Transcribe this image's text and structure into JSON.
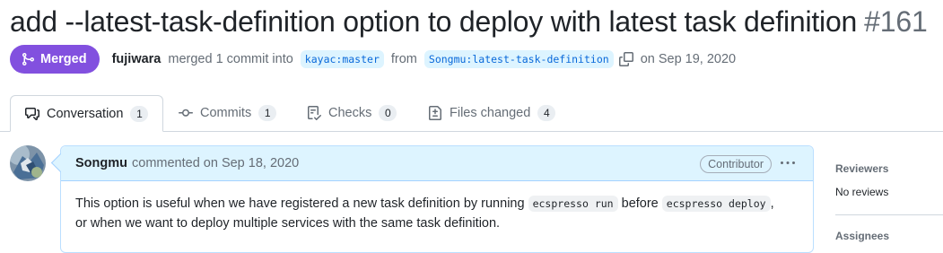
{
  "pr": {
    "title": "add --latest-task-definition option to deploy with latest task definition",
    "number": "#161"
  },
  "meta": {
    "status": "Merged",
    "merger": "fujiwara",
    "merged_text": "merged 1 commit into",
    "base_ref": "kayac:master",
    "from_text": "from",
    "head_ref": "Songmu:latest-task-definition",
    "date_text": "on Sep 19, 2020",
    "status_color": "#8250df"
  },
  "tabs": [
    {
      "label": "Conversation",
      "count": "1",
      "icon": "comment-discussion-icon"
    },
    {
      "label": "Commits",
      "count": "1",
      "icon": "git-commit-icon"
    },
    {
      "label": "Checks",
      "count": "0",
      "icon": "checklist-icon"
    },
    {
      "label": "Files changed",
      "count": "4",
      "icon": "file-diff-icon"
    }
  ],
  "comment": {
    "author": "Songmu",
    "action": "commented on Sep 18, 2020",
    "role": "Contributor",
    "body": {
      "part1": "This option is useful when we have registered a new task definition by running",
      "code1": "ecspresso run",
      "part2": "before",
      "code2": "ecspresso deploy",
      "part3": ",",
      "line2": "or when we want to deploy multiple services with the same task definition."
    }
  },
  "sidebar": {
    "reviewers_heading": "Reviewers",
    "reviewers_value": "No reviews",
    "assignees_heading": "Assignees"
  }
}
